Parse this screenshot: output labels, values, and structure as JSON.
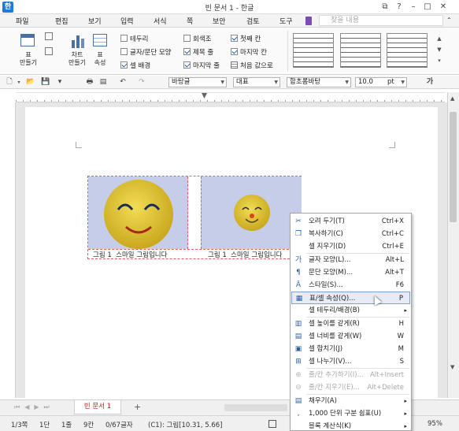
{
  "window": {
    "title": "빈 문서 1 - 한글",
    "app_icon": "한"
  },
  "menubar": {
    "items": [
      "파일",
      "편집",
      "보기",
      "입력",
      "서식",
      "쪽",
      "보안",
      "검토",
      "도구"
    ],
    "search_placeholder": "찾을 내용"
  },
  "ribbon": {
    "table_make": "표\n만들기",
    "chart_make": "차트\n만들기",
    "table_prop": "표\n속성",
    "checks": [
      {
        "label": "테두리",
        "on": false
      },
      {
        "label": "글자/문단 모양",
        "on": false
      },
      {
        "label": "셀 배경",
        "on": true
      },
      {
        "label": "회색조",
        "on": false
      },
      {
        "label": "제목 줄",
        "on": true
      },
      {
        "label": "마지막 줄",
        "on": true
      },
      {
        "label": "첫째 칸",
        "on": true
      },
      {
        "label": "마지막 칸",
        "on": true
      }
    ],
    "reset": "처음 값으로"
  },
  "toolbar": {
    "style": "바탕글",
    "lang": "대표",
    "font": "함초롬바탕",
    "size": "10.0",
    "unit": "pt",
    "font_icon_letter": "가"
  },
  "document": {
    "captions": [
      "그림 1  스마일 그림입니다",
      "그림 1  스마일 그림입니다"
    ],
    "cell_bg": "#c5cde8",
    "face_color": "#e6cc2e"
  },
  "context_menu": {
    "items": [
      {
        "label": "오려 두기(T)",
        "shortcut": "Ctrl+X",
        "icon": "scissors-icon",
        "glyph": "✂",
        "state": "normal"
      },
      {
        "label": "복사하기(C)",
        "shortcut": "Ctrl+C",
        "icon": "copy-icon",
        "glyph": "❐",
        "state": "normal"
      },
      {
        "label": "셀 지우기(D)",
        "shortcut": "Ctrl+E",
        "icon": "",
        "glyph": "",
        "state": "normal"
      },
      {
        "label": "글자 모양(L)...",
        "shortcut": "Alt+L",
        "icon": "font-shape-icon",
        "glyph": "가",
        "state": "normal"
      },
      {
        "label": "문단 모양(M)...",
        "shortcut": "Alt+T",
        "icon": "paragraph-shape-icon",
        "glyph": "¶",
        "state": "normal"
      },
      {
        "label": "스타일(S)...",
        "shortcut": "F6",
        "icon": "style-icon",
        "glyph": "Ā",
        "state": "normal"
      },
      {
        "label": "표/셀 속성(Q)...",
        "shortcut": "P",
        "icon": "table-cell-props-icon",
        "glyph": "▦",
        "state": "highlight"
      },
      {
        "label": "셀 테두리/배경(B)",
        "shortcut": "",
        "icon": "",
        "glyph": "",
        "state": "normal",
        "submenu": true
      },
      {
        "label": "셀 높이를 같게(R)",
        "shortcut": "H",
        "icon": "equal-height-icon",
        "glyph": "▥",
        "state": "normal"
      },
      {
        "label": "셀 너비를 같게(W)",
        "shortcut": "W",
        "icon": "equal-width-icon",
        "glyph": "▤",
        "state": "normal"
      },
      {
        "label": "셀 합치기(J)",
        "shortcut": "M",
        "icon": "merge-cells-icon",
        "glyph": "▣",
        "state": "normal"
      },
      {
        "label": "셀 나누기(V)...",
        "shortcut": "S",
        "icon": "split-cells-icon",
        "glyph": "⊞",
        "state": "normal"
      },
      {
        "label": "줄/칸 추가하기(I)...",
        "shortcut": "Alt+Insert",
        "icon": "add-row-col-icon",
        "glyph": "⊕",
        "state": "disabled"
      },
      {
        "label": "줄/칸 지우기(E)...",
        "shortcut": "Alt+Delete",
        "icon": "delete-row-col-icon",
        "glyph": "⊖",
        "state": "disabled"
      },
      {
        "label": "채우기(A)",
        "shortcut": "",
        "icon": "fill-icon",
        "glyph": "▤",
        "state": "normal",
        "submenu": true
      },
      {
        "label": "1,000 단위 구분 쉼표(U)",
        "shortcut": "",
        "icon": "comma-icon",
        "glyph": ",",
        "state": "normal",
        "submenu": true
      },
      {
        "label": "블록 계산식(K)",
        "shortcut": "",
        "icon": "",
        "glyph": "",
        "state": "normal",
        "submenu": true
      }
    ]
  },
  "tabs": {
    "doc_tab": "빈 문서 1",
    "add": "+"
  },
  "status": {
    "page": "1/3쪽",
    "section": "1단",
    "line": "1줄",
    "col": "9칸",
    "chars": "0/67글자",
    "cell": "(C1): 그림[10.31, 5.66]",
    "zoom": "95%"
  }
}
